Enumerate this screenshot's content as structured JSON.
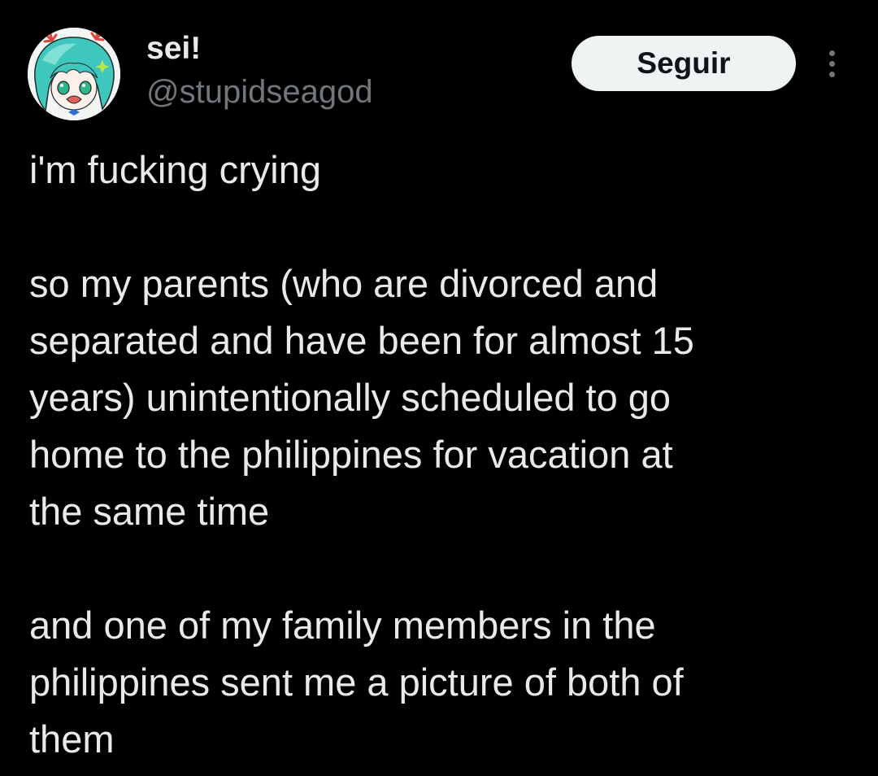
{
  "author": {
    "display_name": "sei!",
    "handle": "@stupidseagod",
    "avatar_icon": "anime-character-avatar"
  },
  "actions": {
    "follow_label": "Seguir",
    "more_icon": "more-options-icon"
  },
  "post": {
    "paragraphs": [
      "i'm fucking crying",
      "so my parents (who are divorced and\nseparated and have been for almost 15\nyears) unintentionally scheduled to go\nhome to the philippines for vacation at\nthe same time",
      "and one of my family members in the\nphilippines sent me a picture of both of\nthem"
    ]
  },
  "colors": {
    "background": "#000000",
    "primary_text": "#e7e9ea",
    "secondary_text": "#71767b",
    "button_bg": "#eff3f4",
    "button_text": "#0f1419"
  }
}
